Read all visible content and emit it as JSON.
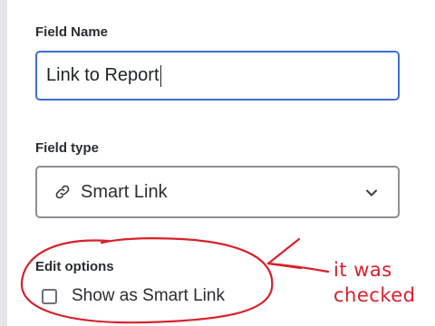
{
  "field_name": {
    "label": "Field Name",
    "value": "Link to Report"
  },
  "field_type": {
    "label": "Field type",
    "selected": "Smart Link",
    "icon": "link-icon"
  },
  "edit_options": {
    "label": "Edit options",
    "checkbox_label": "Show as Smart Link",
    "checked": false
  },
  "annotation": {
    "line1": "it was",
    "line2": "checked",
    "color": "#d9202a"
  },
  "colors": {
    "focus_border": "#3f6fd6",
    "select_border": "#8b8f96"
  }
}
